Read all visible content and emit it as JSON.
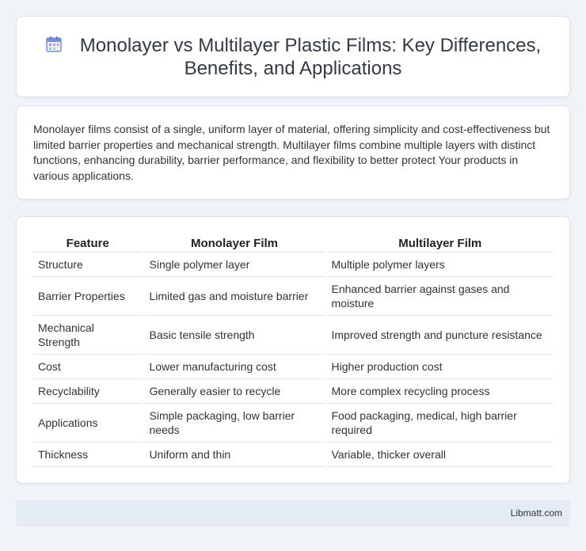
{
  "header": {
    "title": "Monolayer vs Multilayer Plastic Films: Key Differences, Benefits, and Applications",
    "icon": "calendar-icon",
    "icon_color": "#7b8fd6"
  },
  "intro": {
    "text": "Monolayer films consist of a single, uniform layer of material, offering simplicity and cost-effectiveness but limited barrier properties and mechanical strength. Multilayer films combine multiple layers with distinct functions, enhancing durability, barrier performance, and flexibility to better protect Your products in various applications."
  },
  "table": {
    "headers": [
      "Feature",
      "Monolayer Film",
      "Multilayer Film"
    ],
    "rows": [
      [
        "Structure",
        "Single polymer layer",
        "Multiple polymer layers"
      ],
      [
        "Barrier Properties",
        "Limited gas and moisture barrier",
        "Enhanced barrier against gases and moisture"
      ],
      [
        "Mechanical Strength",
        "Basic tensile strength",
        "Improved strength and puncture resistance"
      ],
      [
        "Cost",
        "Lower manufacturing cost",
        "Higher production cost"
      ],
      [
        "Recyclability",
        "Generally easier to recycle",
        "More complex recycling process"
      ],
      [
        "Applications",
        "Simple packaging, low barrier needs",
        "Food packaging, medical, high barrier required"
      ],
      [
        "Thickness",
        "Uniform and thin",
        "Variable, thicker overall"
      ]
    ]
  },
  "footer": {
    "link": "Libmatt.com"
  },
  "colors": {
    "background": "#f0f3f8",
    "footer_bg": "#e4ebf5"
  }
}
